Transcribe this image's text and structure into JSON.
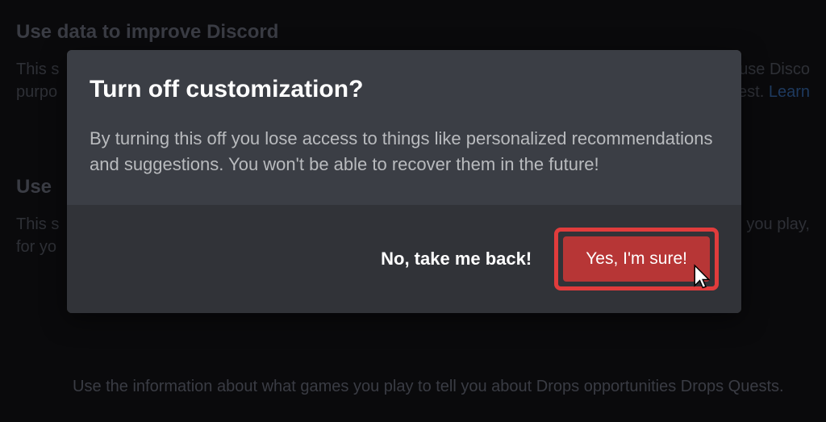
{
  "background": {
    "heading1": "Use data to improve Discord",
    "text1_left": "This s",
    "text1_right": " use Disco",
    "text1_end": "est.",
    "link": "Learn",
    "text1_label": "purpo",
    "heading2": "Use ",
    "text2_left": "This s",
    "text2_right": " you play,",
    "text2_for": "for yo",
    "text3": "Use the information about what games you play to tell you about Drops opportunities Drops Quests."
  },
  "modal": {
    "title": "Turn off customization?",
    "description": "By turning this off you lose access to things like personalized recommendations and suggestions. You won't be able to recover them in the future!",
    "cancel_label": "No, take me back!",
    "confirm_label": "Yes, I'm sure!"
  }
}
